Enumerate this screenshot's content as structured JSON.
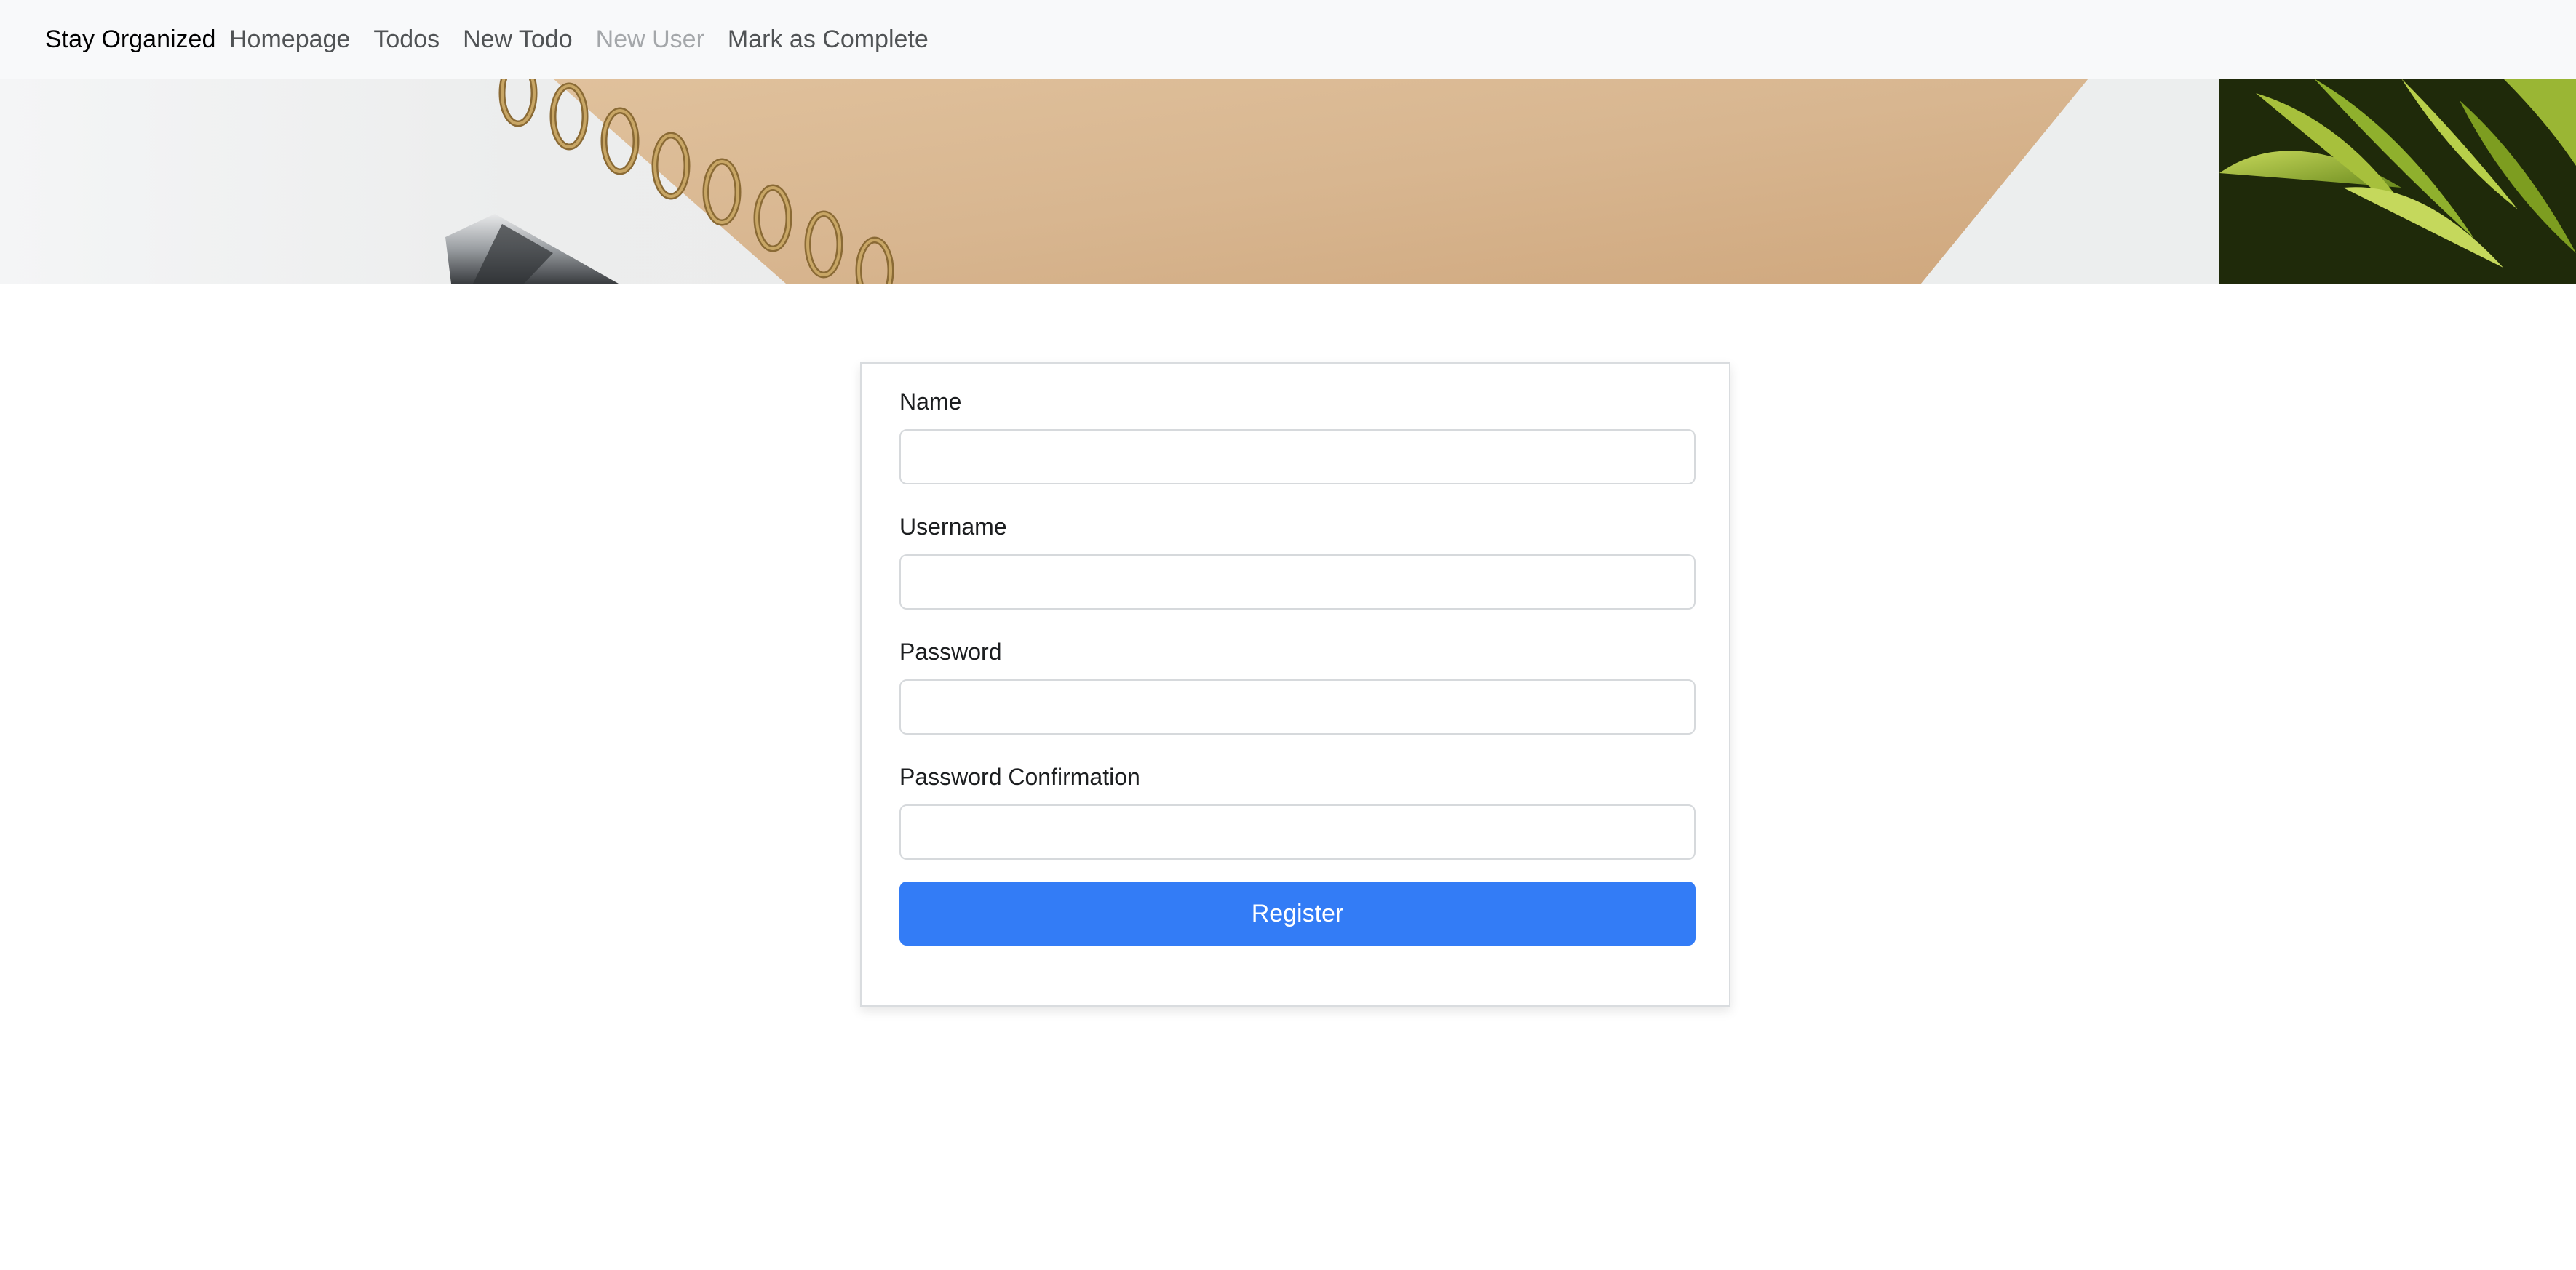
{
  "navbar": {
    "brand": "Stay Organized",
    "links": [
      {
        "label": "Homepage",
        "active": false
      },
      {
        "label": "Todos",
        "active": false
      },
      {
        "label": "New Todo",
        "active": false
      },
      {
        "label": "New User",
        "active": true
      },
      {
        "label": "Mark as Complete",
        "active": false
      }
    ]
  },
  "banner": {
    "image": "desk-notebook-pen-plant-photo"
  },
  "form": {
    "fields": [
      {
        "label": "Name",
        "value": "",
        "type": "text"
      },
      {
        "label": "Username",
        "value": "",
        "type": "text"
      },
      {
        "label": "Password",
        "value": "",
        "type": "password"
      },
      {
        "label": "Password Confirmation",
        "value": "",
        "type": "password"
      }
    ],
    "submit_label": "Register"
  },
  "colors": {
    "navbar_bg": "#f8f9fa",
    "primary_button": "#337cf6",
    "active_link": "#a4a7aa"
  }
}
